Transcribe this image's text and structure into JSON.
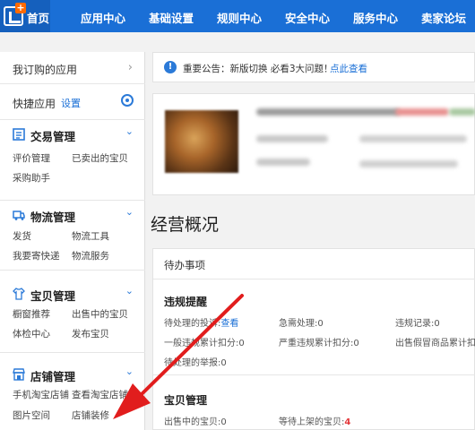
{
  "nav": {
    "home": "首页",
    "items": [
      "应用中心",
      "基础设置",
      "规则中心",
      "安全中心",
      "服务中心",
      "卖家论坛"
    ]
  },
  "sidebar": {
    "my_apps": "我订购的应用",
    "quick_apps": "快捷应用",
    "settings_link": "设置",
    "sections": [
      {
        "title": "交易管理",
        "icon": "trade-icon",
        "links": [
          "评价管理",
          "已卖出的宝贝",
          "采购助手"
        ]
      },
      {
        "title": "物流管理",
        "icon": "truck-icon",
        "links": [
          "发货",
          "物流工具",
          "我要寄快递",
          "物流服务"
        ]
      },
      {
        "title": "宝贝管理",
        "icon": "shirt-icon",
        "links": [
          "橱窗推荐",
          "出售中的宝贝",
          "体检中心",
          "发布宝贝"
        ]
      },
      {
        "title": "店铺管理",
        "icon": "shop-icon",
        "links": [
          "手机淘宝店铺",
          "查看淘宝店铺",
          "图片空间",
          "店铺装修"
        ]
      }
    ]
  },
  "notice": {
    "text": "重要公告：新版切换 必看3大问题！",
    "link": "点此查看"
  },
  "overview": {
    "title": "经营概况"
  },
  "todo": {
    "header": "待办事项",
    "violations": {
      "title": "违规提醒",
      "pending_complaints": "待处理的投诉:",
      "pending_complaints_link": "查看",
      "urgent": "急需处理:0",
      "records": "违规记录:0",
      "general": "一般违规累计扣分:0",
      "serious": "严重违规累计扣分:0",
      "fake": "出售假冒商品累计扣",
      "pending_reports": "待处理的举报:0"
    },
    "items": {
      "title": "宝贝管理",
      "on_sale_label": "出售中的宝贝:",
      "on_sale_value": "0",
      "waiting_label": "等待上架的宝贝:",
      "waiting_value": "4"
    }
  },
  "colors": {
    "nav_bg": "#1a6fd6",
    "accent": "#2b7ad8",
    "arrow": "#e11d1d",
    "count_red": "#e4393c"
  }
}
